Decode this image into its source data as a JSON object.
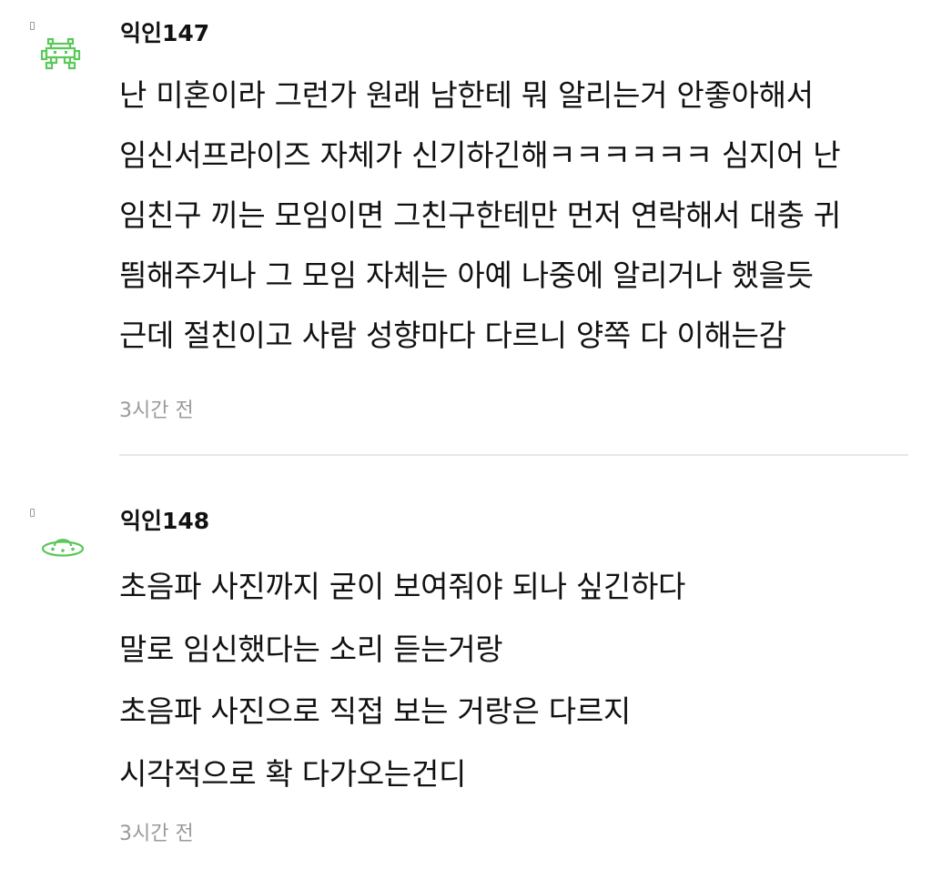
{
  "comments": [
    {
      "author": "익인147",
      "avatar_icon": "pixel-invader-icon",
      "avatar_color": "#5ac85a",
      "lines": [
        "난 미혼이라 그런가 원래 남한테 뭐 알리는거 안좋아해서",
        "임신서프라이즈 자체가 신기하긴해ㅋㅋㅋㅋㅋㅋ 심지어 난",
        "임친구 끼는 모임이면 그친구한테만 먼저 연락해서 대충 귀",
        "띔해주거나 그 모임 자체는 아예 나중에 알리거나 했을듯",
        "근데 절친이고 사람 성향마다 다르니 양쪽 다 이해는감"
      ],
      "time": "3시간 전"
    },
    {
      "author": "익인148",
      "avatar_icon": "ufo-icon",
      "avatar_color": "#5ac85a",
      "lines": [
        "초음파 사진까지 굳이 보여줘야 되나 싶긴하다",
        "말로 임신했다는 소리 듣는거랑",
        "초음파 사진으로 직접 보는 거랑은 다르지",
        "시각적으로 확 다가오는건디"
      ],
      "time": "3시간 전"
    }
  ]
}
